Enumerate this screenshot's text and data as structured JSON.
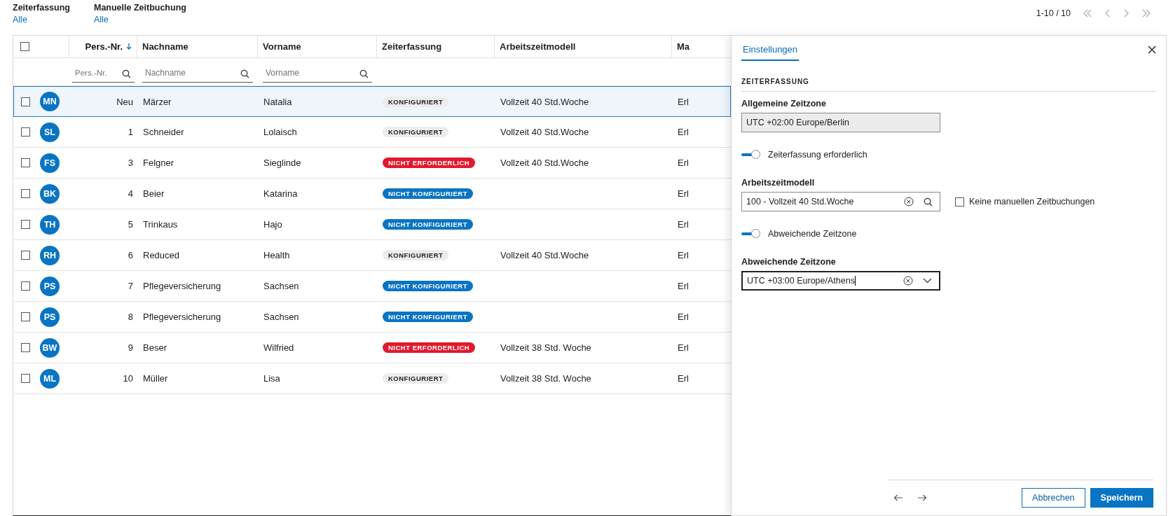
{
  "filters": [
    {
      "label": "Zeiterfassung",
      "value": "Alle"
    },
    {
      "label": "Manuelle Zeitbuchung",
      "value": "Alle"
    }
  ],
  "pagination": {
    "range": "1-10 / 10"
  },
  "table": {
    "select_all": {
      "checked": false
    },
    "columns": [
      {
        "label": "Pers.-Nr.",
        "sorted": true
      },
      {
        "label": "Nachname",
        "sorted": false
      },
      {
        "label": "Vorname",
        "sorted": false
      },
      {
        "label": "Zeiterfassung",
        "sorted": false
      },
      {
        "label": "Arbeitszeitmodell",
        "sorted": false
      },
      {
        "label": "Ma",
        "sorted": false
      }
    ],
    "filter_placeholders": [
      "Pers.-Nr.",
      "Nachname",
      "Vorname"
    ],
    "rows": [
      {
        "initials": "MN",
        "nr": "Neu",
        "nachname": "Märzer",
        "vorname": "Natalia",
        "status": {
          "kind": "konfiguriert",
          "label": "KONFIGURIERT"
        },
        "modell": "Vollzeit 40 Std.Woche",
        "column_7": "Erl",
        "checked": false,
        "selected": true
      },
      {
        "initials": "SL",
        "nr": "1",
        "nachname": "Schneider",
        "vorname": "Lolaisch",
        "status": {
          "kind": "konfiguriert",
          "label": "KONFIGURIERT"
        },
        "modell": "Vollzeit 40 Std.Woche",
        "column_7": "Erl",
        "checked": false,
        "selected": false
      },
      {
        "initials": "FS",
        "nr": "3",
        "nachname": "Felgner",
        "vorname": "Sieglinde",
        "status": {
          "kind": "nicht_erforderlich",
          "label": "NICHT ERFORDERLICH"
        },
        "modell": "Vollzeit 40 Std.Woche",
        "column_7": "Erl",
        "checked": false,
        "selected": false
      },
      {
        "initials": "BK",
        "nr": "4",
        "nachname": "Beier",
        "vorname": "Katarina",
        "status": {
          "kind": "nicht_konfiguriert",
          "label": "NICHT KONFIGURIERT"
        },
        "column_7": "Erl",
        "checked": false,
        "selected": false
      },
      {
        "initials": "TH",
        "nr": "5",
        "nachname": "Trinkaus",
        "vorname": "Hajo",
        "status": {
          "kind": "nicht_konfiguriert",
          "label": "NICHT KONFIGURIERT"
        },
        "column_7": "Erl",
        "checked": false,
        "selected": false
      },
      {
        "initials": "RH",
        "nr": "6",
        "nachname": "Reduced",
        "vorname": "Health",
        "status": {
          "kind": "konfiguriert",
          "label": "KONFIGURIERT"
        },
        "modell": "Vollzeit 40 Std.Woche",
        "column_7": "Erl",
        "checked": false,
        "selected": false
      },
      {
        "initials": "PS",
        "nr": "7",
        "nachname": "Pflegeversicherung",
        "vorname": "Sachsen",
        "status": {
          "kind": "nicht_konfiguriert",
          "label": "NICHT KONFIGURIERT"
        },
        "column_7": "Erl",
        "checked": false,
        "selected": false
      },
      {
        "initials": "PS",
        "nr": "8",
        "nachname": "Pflegeversicherung",
        "vorname": "Sachsen",
        "status": {
          "kind": "nicht_konfiguriert",
          "label": "NICHT KONFIGURIERT"
        },
        "column_7": "Erl",
        "checked": false,
        "selected": false
      },
      {
        "initials": "BW",
        "nr": "9",
        "nachname": "Beser",
        "vorname": "Wilfried",
        "status": {
          "kind": "nicht_erforderlich",
          "label": "NICHT ERFORDERLICH"
        },
        "modell": "Vollzeit 38 Std. Woche",
        "column_7": "Erl",
        "checked": false,
        "selected": false
      },
      {
        "initials": "ML",
        "nr": "10",
        "nachname": "Müller",
        "vorname": "Lisa",
        "status": {
          "kind": "konfiguriert",
          "label": "KONFIGURIERT"
        },
        "modell": "Vollzeit 38 Std. Woche",
        "column_7": "Erl",
        "checked": false,
        "selected": false
      }
    ]
  },
  "panel": {
    "tabs": [
      {
        "label": "Einstellungen",
        "selected": true
      }
    ],
    "section": "ZEITERFASSUNG",
    "general_timezone": {
      "label": "Allgemeine Zeitzone",
      "value": "UTC +02:00 Europe/Berlin",
      "disabled": true
    },
    "toggle_required": {
      "label": "Zeiterfassung erforderlich",
      "on": true
    },
    "work_model": {
      "label": "Arbeitszeitmodell",
      "value": "100 - Vollzeit 40 Std.Woche"
    },
    "no_manual": {
      "label": "Keine manuellen Zeitbuchungen",
      "checked": false
    },
    "toggle_deviating": {
      "label": "Abweichende Zeitzone",
      "on": true
    },
    "deviating_timezone": {
      "label": "Abweichende Zeitzone",
      "value": "UTC +03:00 Europe/Athens",
      "focused": true
    },
    "buttons": [
      {
        "kind": "secondary",
        "label": "Abbrechen"
      },
      {
        "kind": "primary",
        "label": "Speichern"
      }
    ]
  }
}
